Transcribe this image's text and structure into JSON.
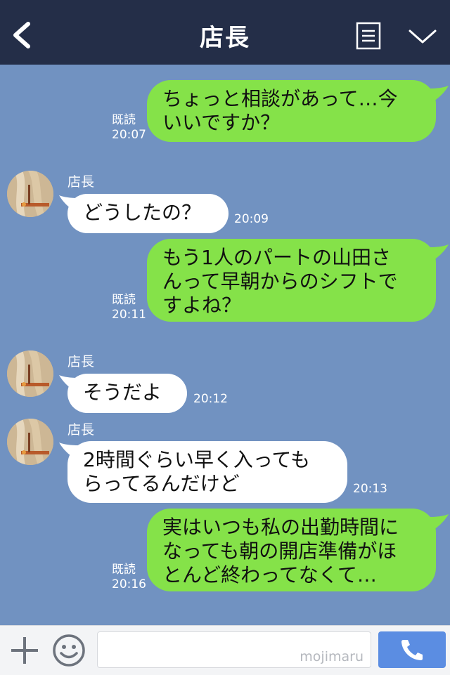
{
  "header": {
    "title": "店長",
    "back_icon": "chevron-left-icon",
    "menu_icon": "notes-icon",
    "dropdown_icon": "chevron-down-icon"
  },
  "messages": [
    {
      "direction": "out",
      "text": "ちょっと相談があって…今\nいいですか？",
      "read": "既読",
      "time": "20:07"
    },
    {
      "direction": "in",
      "sender": "店長",
      "text": "どうしたの？",
      "time": "20:09"
    },
    {
      "direction": "out",
      "text": "もう1人のパートの山田さ\nんって早朝からのシフトで\nすよね？",
      "read": "既読",
      "time": "20:11"
    },
    {
      "direction": "in",
      "sender": "店長",
      "text": "そうだよ",
      "time": "20:12"
    },
    {
      "direction": "in",
      "sender": "店長",
      "text": "2時間ぐらい早く入っても\nらってるんだけど",
      "time": "20:13"
    },
    {
      "direction": "out",
      "text": "実はいつも私の出勤時間に\nなっても朝の開店準備がほ\nとんど終わってなくて…",
      "read": "既読",
      "time": "20:16"
    }
  ],
  "footer": {
    "plus_icon": "plus-icon",
    "sticker_icon": "smile-icon",
    "input_value": "",
    "watermark": "mojimaru",
    "call_icon": "phone-icon"
  },
  "colors": {
    "header_bg": "#242e48",
    "chat_bg": "#7192c1",
    "outgoing_bubble": "#85e249",
    "incoming_bubble": "#ffffff",
    "call_button": "#5b8de2"
  }
}
